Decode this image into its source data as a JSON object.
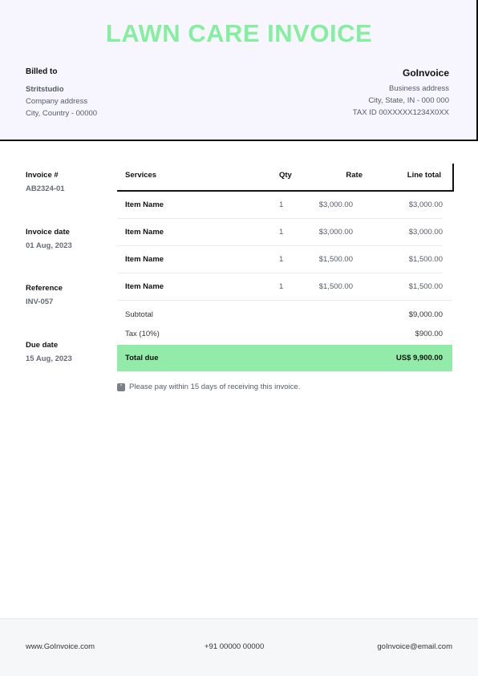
{
  "title": "LAWN CARE INVOICE",
  "billed_to": {
    "label": "Billed to",
    "name": "Stritstudio",
    "address": "Company address",
    "city": "City, Country - 00000"
  },
  "business": {
    "name": "GoInvoice",
    "address": "Business address",
    "city": "City, State, IN - 000 000",
    "tax_id": "TAX ID 00XXXXX1234X0XX"
  },
  "meta": {
    "invoice_label": "Invoice #",
    "invoice_value": "AB2324-01",
    "date_label": "Invoice date",
    "date_value": "01 Aug, 2023",
    "reference_label": "Reference",
    "reference_value": "INV-057",
    "due_label": "Due date",
    "due_value": "15 Aug, 2023"
  },
  "table": {
    "headers": {
      "services": "Services",
      "qty": "Qty",
      "rate": "Rate",
      "line_total": "Line total"
    },
    "rows": [
      {
        "name": "Item Name",
        "qty": "1",
        "rate": "$3,000.00",
        "total": "$3,000.00"
      },
      {
        "name": "Item Name",
        "qty": "1",
        "rate": "$3,000.00",
        "total": "$3,000.00"
      },
      {
        "name": "Item Name",
        "qty": "1",
        "rate": "$1,500.00",
        "total": "$1,500.00"
      },
      {
        "name": "Item Name",
        "qty": "1",
        "rate": "$1,500.00",
        "total": "$1,500.00"
      }
    ],
    "subtotal_label": "Subtotal",
    "subtotal_value": "$9,000.00",
    "tax_label": "Tax (10%)",
    "tax_value": "$900.00",
    "total_label": "Total due",
    "total_value": "US$ 9,900.00"
  },
  "note": {
    "icon": "quote-icon",
    "text": "Please pay within 15 days of receiving this invoice."
  },
  "footer": {
    "website": "www.GoInvoice.com",
    "phone": "+91 00000 00000",
    "email": "goInvoice@email.com"
  },
  "colors": {
    "accent": "#86ef9f",
    "total_bg": "#92eba8",
    "header_bg": "#f7f5fd"
  }
}
